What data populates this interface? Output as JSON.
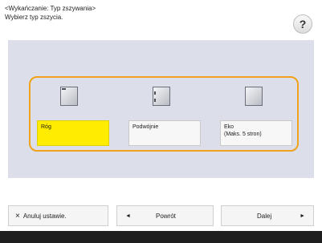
{
  "header": {
    "title": "<Wykańczanie: Typ zszywania>",
    "instruction": "Wybierz typ zszycia.",
    "help_label": "?"
  },
  "options": [
    {
      "label": "Róg",
      "selected": true,
      "icon": "corner-staple-icon"
    },
    {
      "label": "Podwójnie",
      "selected": false,
      "icon": "double-staple-icon"
    },
    {
      "label_line1": "Eko",
      "label_line2": "(Maks. 5 stron)",
      "selected": false,
      "icon": "eco-staple-icon"
    }
  ],
  "footer": {
    "reset_label": "Anuluj ustawie.",
    "reset_icon": "×",
    "back_label": "Powrót",
    "back_icon": "◄",
    "next_label": "Dalej",
    "next_icon": "►"
  },
  "colors": {
    "selected": "#ffec00",
    "frame": "#f0a21b",
    "panel": "#dcdfea"
  }
}
